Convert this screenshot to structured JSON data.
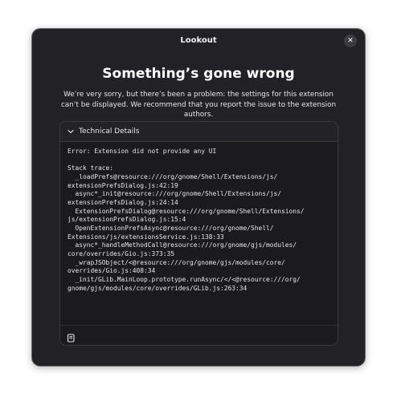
{
  "window": {
    "title": "Lookout",
    "close_glyph": "✕"
  },
  "dialog": {
    "heading": "Something’s gone wrong",
    "message": "We’re very sorry, but there’s been a problem: the settings for this extension can’t be displayed. We recommend that you report the issue to the extension authors."
  },
  "details": {
    "label": "Technical Details",
    "expanded": true,
    "chevron_icon": "chevron-down-icon",
    "trace_text": "Error: Extension did not provide any UI\n\nStack trace:\n  _loadPrefs@resource:///org/gnome/Shell/Extensions/js/\nextensionPrefsDialog.js:42:19\n  async*_init@resource:///org/gnome/Shell/Extensions/js/\nextensionPrefsDialog.js:24:14\n  ExtensionPrefsDialog@resource:///org/gnome/Shell/Extensions/\njs/extensionPrefsDialog.js:15:4\n  OpenExtensionPrefsAsync@resource:///org/gnome/Shell/\nExtensions/js/extensionsService.js:138:33\n  async*_handleMethodCall@resource:///org/gnome/gjs/modules/\ncore/overrides/Gio.js:373:35\n  _wrapJSObject/<@resource:///org/gnome/gjs/modules/core/\noverrides/Gio.js:408:34\n  _init/GLib.MainLoop.prototype.runAsync/</<@resource:///org/\ngnome/gjs/modules/core/overrides/GLib.js:263:34",
    "copy_icon": "copy-icon"
  },
  "colors": {
    "window_bg": "#222226",
    "panel_bg": "#1b1b1e",
    "text": "#ffffff"
  }
}
